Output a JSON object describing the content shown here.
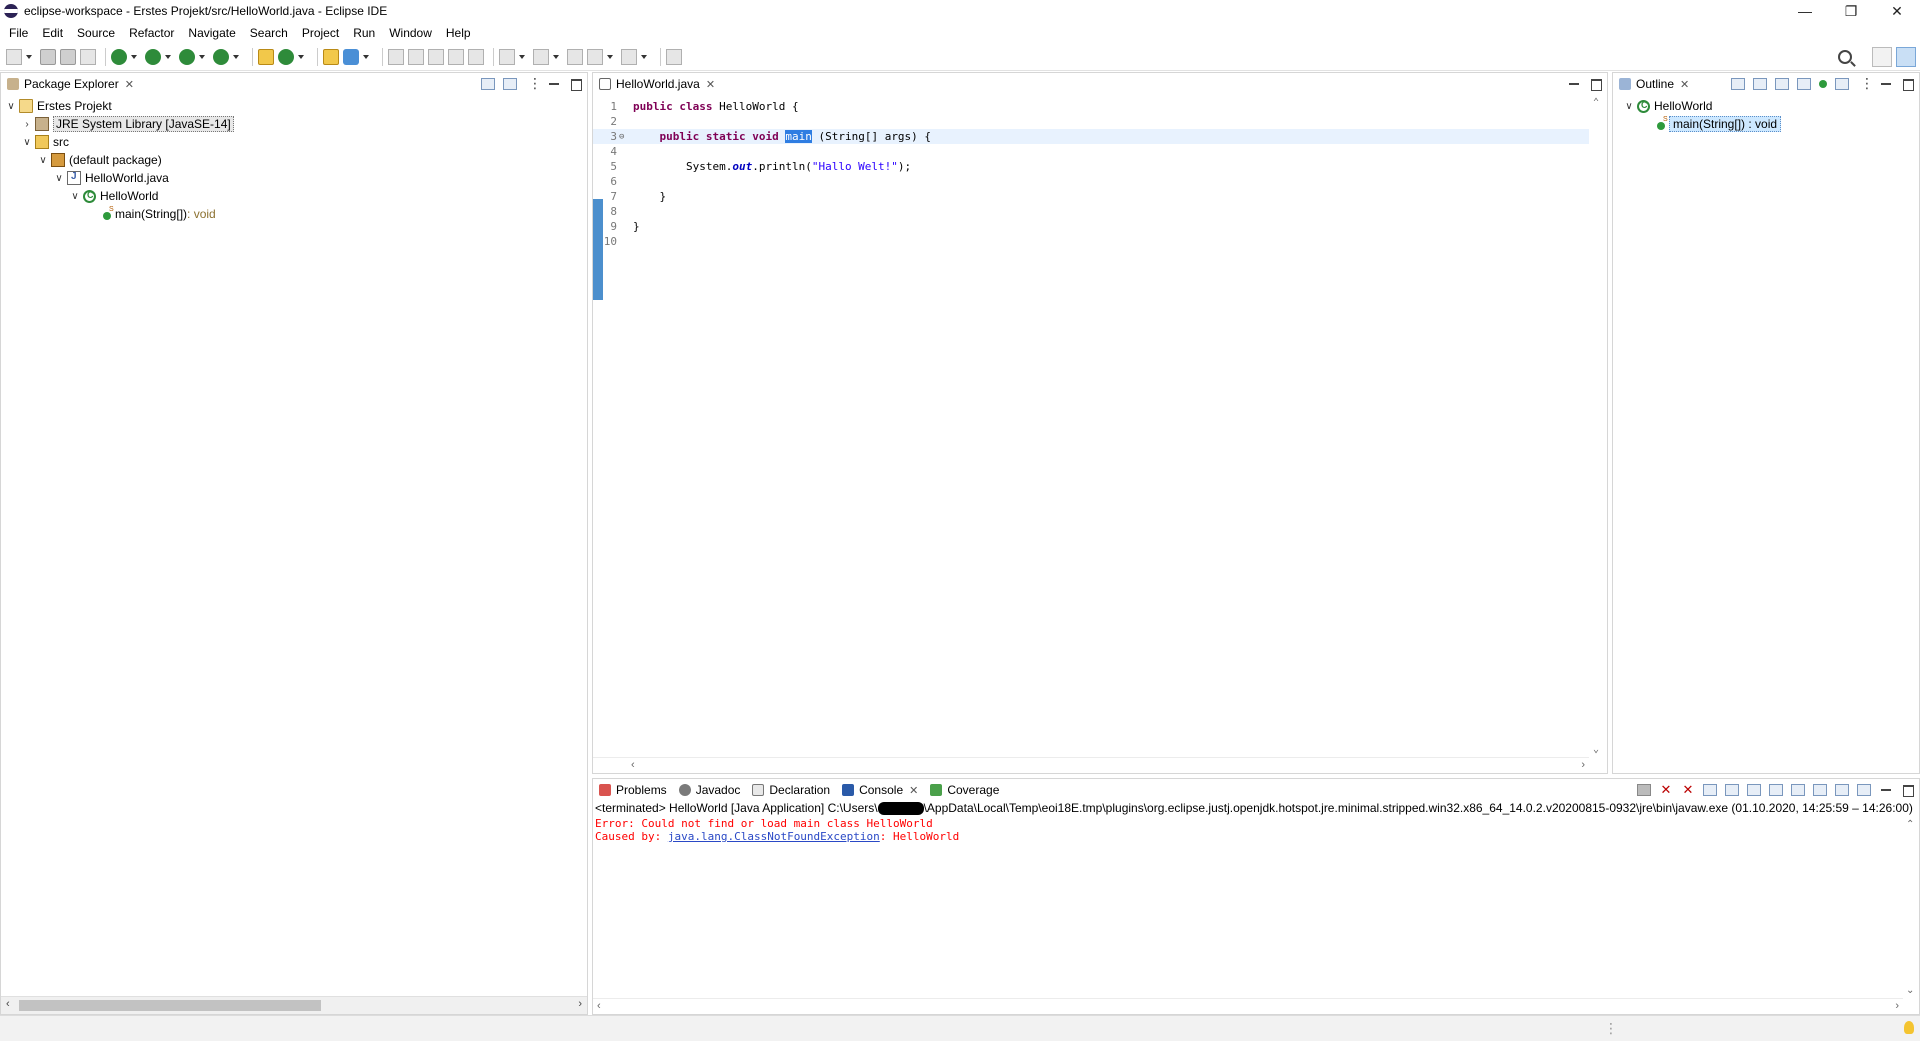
{
  "window": {
    "title": "eclipse-workspace - Erstes Projekt/src/HelloWorld.java - Eclipse IDE",
    "minimize_glyph": "—",
    "restore_glyph": "❐",
    "close_glyph": "✕"
  },
  "menu": [
    "File",
    "Edit",
    "Source",
    "Refactor",
    "Navigate",
    "Search",
    "Project",
    "Run",
    "Window",
    "Help"
  ],
  "package_explorer": {
    "tab_label": "Package Explorer",
    "tree": {
      "project": "Erstes Projekt",
      "library": "JRE System Library [JavaSE-14]",
      "src": "src",
      "package": "(default package)",
      "file": "HelloWorld.java",
      "class": "HelloWorld",
      "method_name": "main(String[])",
      "method_type": " : void"
    }
  },
  "editor": {
    "tab_label": "HelloWorld.java",
    "line_numbers": [
      "1",
      "2",
      "3",
      "4",
      "5",
      "6",
      "7",
      "8",
      "9",
      "10"
    ],
    "code": {
      "l1_kw": "public class",
      "l1_rest": " HelloWorld {",
      "l3_kw": "public static void",
      "l3_sel": "main",
      "l3_rest": " (String[] args) {",
      "l5_pre": "System.",
      "l5_field": "out",
      "l5_mid": ".println(",
      "l5_str": "\"Hallo Welt!\"",
      "l5_end": ");",
      "l7": "}",
      "l9": "}"
    }
  },
  "outline": {
    "tab_label": "Outline",
    "class": "HelloWorld",
    "method": "main(String[]) : void"
  },
  "bottom_tabs": {
    "problems": "Problems",
    "javadoc": "Javadoc",
    "declaration": "Declaration",
    "console": "Console",
    "coverage": "Coverage"
  },
  "console": {
    "header_before": "<terminated> HelloWorld [Java Application] C:\\Users\\",
    "header_after": "\\AppData\\Local\\Temp\\eoi18E.tmp\\plugins\\org.eclipse.justj.openjdk.hotspot.jre.minimal.stripped.win32.x86_64_14.0.2.v20200815-0932\\jre\\bin\\javaw.exe  (01.10.2020, 14:25:59 – 14:26:00)",
    "error_line": "Error: Could not find or load main class HelloWorld",
    "caused_by": "Caused by: ",
    "exception": "java.lang.ClassNotFoundException",
    "exception_suffix": ": HelloWorld"
  },
  "icons": {
    "expanded": "∨",
    "collapsed": "›",
    "close": "✕",
    "left_arrow": "‹",
    "right_arrow": "›",
    "up_arrow": "⌃",
    "down_arrow": "⌄",
    "fold": "⊖",
    "status_dots": "⋮"
  },
  "colors": {
    "keyword": "#7f0055",
    "string": "#2a00ff",
    "error": "#ff0000",
    "selection": "#2e7de2"
  }
}
